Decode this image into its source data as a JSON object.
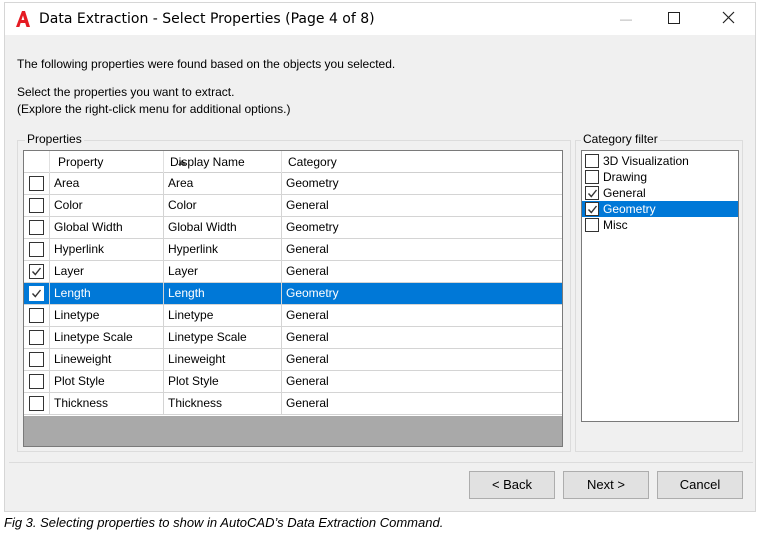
{
  "window": {
    "title": "Data Extraction - Select Properties (Page 4 of 8)",
    "icon": "autocad-logo-icon",
    "minimize_glyph": "—",
    "maximize_glyph": "☐",
    "close_glyph": "✕"
  },
  "intro": {
    "line1": "The following properties were found based on the objects you selected.",
    "line2": "Select the properties you want to extract.",
    "line3": "(Explore the right-click menu for additional options.)"
  },
  "properties": {
    "group_label": "Properties",
    "columns": [
      "Property",
      "Display Name",
      "Category"
    ],
    "sort_column": "Property",
    "rows": [
      {
        "property": "Area",
        "display": "Area",
        "category": "Geometry",
        "checked": false,
        "selected": false
      },
      {
        "property": "Color",
        "display": "Color",
        "category": "General",
        "checked": false,
        "selected": false
      },
      {
        "property": "Global Width",
        "display": "Global Width",
        "category": "Geometry",
        "checked": false,
        "selected": false
      },
      {
        "property": "Hyperlink",
        "display": "Hyperlink",
        "category": "General",
        "checked": false,
        "selected": false
      },
      {
        "property": "Layer",
        "display": "Layer",
        "category": "General",
        "checked": true,
        "selected": false
      },
      {
        "property": "Length",
        "display": "Length",
        "category": "Geometry",
        "checked": true,
        "selected": true
      },
      {
        "property": "Linetype",
        "display": "Linetype",
        "category": "General",
        "checked": false,
        "selected": false
      },
      {
        "property": "Linetype Scale",
        "display": "Linetype Scale",
        "category": "General",
        "checked": false,
        "selected": false
      },
      {
        "property": "Lineweight",
        "display": "Lineweight",
        "category": "General",
        "checked": false,
        "selected": false
      },
      {
        "property": "Plot Style",
        "display": "Plot Style",
        "category": "General",
        "checked": false,
        "selected": false
      },
      {
        "property": "Thickness",
        "display": "Thickness",
        "category": "General",
        "checked": false,
        "selected": false
      }
    ]
  },
  "category_filter": {
    "group_label": "Category filter",
    "items": [
      {
        "label": "3D Visualization",
        "checked": false,
        "selected": false
      },
      {
        "label": "Drawing",
        "checked": false,
        "selected": false
      },
      {
        "label": "General",
        "checked": true,
        "selected": false
      },
      {
        "label": "Geometry",
        "checked": true,
        "selected": true
      },
      {
        "label": "Misc",
        "checked": false,
        "selected": false
      }
    ]
  },
  "buttons": {
    "back": "< Back",
    "next": "Next >",
    "cancel": "Cancel"
  },
  "caption": "Fig 3. Selecting properties to show in AutoCAD’s Data Extraction Command.",
  "colors": {
    "selection": "#0078d7",
    "logo_red": "#e51b23"
  }
}
